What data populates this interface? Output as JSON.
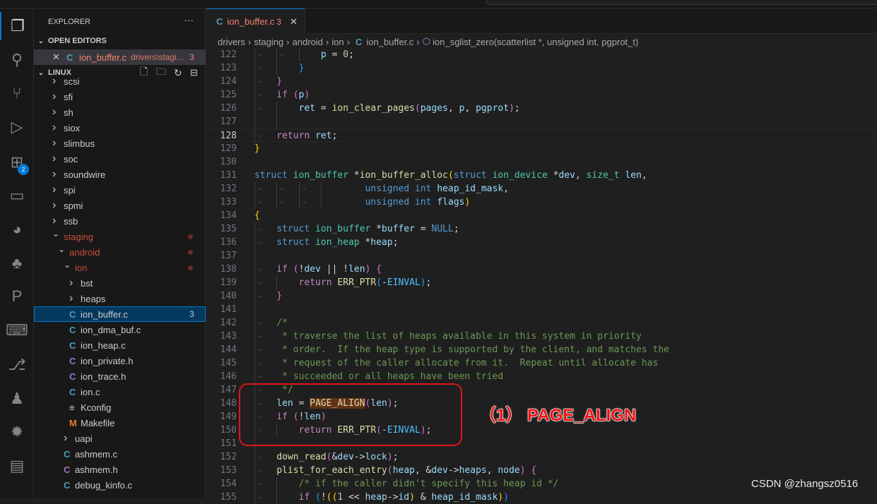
{
  "activity_bar": [
    {
      "icon": "explorer-icon",
      "glyph": "❐",
      "active": true
    },
    {
      "icon": "search-icon",
      "glyph": "⚲"
    },
    {
      "icon": "source-control-icon",
      "glyph": "⑂"
    },
    {
      "icon": "run-debug-icon",
      "glyph": "▷"
    },
    {
      "icon": "extensions-icon",
      "glyph": "⊞",
      "badge": "2"
    },
    {
      "icon": "remote-explorer-icon",
      "glyph": "▭"
    },
    {
      "icon": "pacman-icon",
      "glyph": "◕"
    },
    {
      "icon": "python-icon",
      "glyph": "♣"
    },
    {
      "icon": "p-extension-icon",
      "glyph": "P"
    },
    {
      "icon": "terminal-icon",
      "glyph": "⌨"
    },
    {
      "icon": "git-graph-icon",
      "glyph": "⎇"
    },
    {
      "icon": "linux-icon",
      "glyph": "♟"
    },
    {
      "icon": "rt-thread-icon",
      "glyph": "✹"
    },
    {
      "icon": "folder-icon",
      "glyph": "▤"
    }
  ],
  "sidebar": {
    "title": "EXPLORER",
    "more": "···",
    "open_editors": {
      "label": "OPEN EDITORS",
      "file": "ion_buffer.c",
      "path": "drivers\\stagi...",
      "count": "3"
    },
    "workspace": {
      "label": "LINUX"
    },
    "tree": [
      {
        "name": "scsi",
        "type": "folder",
        "depth": 0
      },
      {
        "name": "sfi",
        "type": "folder",
        "depth": 0
      },
      {
        "name": "sh",
        "type": "folder",
        "depth": 0
      },
      {
        "name": "siox",
        "type": "folder",
        "depth": 0
      },
      {
        "name": "slimbus",
        "type": "folder",
        "depth": 0
      },
      {
        "name": "soc",
        "type": "folder",
        "depth": 0
      },
      {
        "name": "soundwire",
        "type": "folder",
        "depth": 0
      },
      {
        "name": "spi",
        "type": "folder",
        "depth": 0
      },
      {
        "name": "spmi",
        "type": "folder",
        "depth": 0
      },
      {
        "name": "ssb",
        "type": "folder",
        "depth": 0
      },
      {
        "name": "staging",
        "type": "folder",
        "depth": 0,
        "open": true,
        "modified": true
      },
      {
        "name": "android",
        "type": "folder",
        "depth": 1,
        "open": true,
        "modified": true
      },
      {
        "name": "ion",
        "type": "folder",
        "depth": 2,
        "open": true,
        "modified": true
      },
      {
        "name": "bst",
        "type": "folder",
        "depth": 3
      },
      {
        "name": "heaps",
        "type": "folder",
        "depth": 3
      },
      {
        "name": "ion_buffer.c",
        "type": "c",
        "depth": 3,
        "selected": true,
        "count": "3"
      },
      {
        "name": "ion_dma_buf.c",
        "type": "c",
        "depth": 3
      },
      {
        "name": "ion_heap.c",
        "type": "c",
        "depth": 3
      },
      {
        "name": "ion_private.h",
        "type": "h",
        "depth": 3
      },
      {
        "name": "ion_trace.h",
        "type": "h",
        "depth": 3
      },
      {
        "name": "ion.c",
        "type": "c",
        "depth": 3
      },
      {
        "name": "Kconfig",
        "type": "kconfig",
        "depth": 3
      },
      {
        "name": "Makefile",
        "type": "make",
        "depth": 3
      },
      {
        "name": "uapi",
        "type": "folder",
        "depth": 2
      },
      {
        "name": "ashmem.c",
        "type": "c",
        "depth": 2
      },
      {
        "name": "ashmem.h",
        "type": "h",
        "depth": 2
      },
      {
        "name": "debug_kinfo.c",
        "type": "c",
        "depth": 2
      }
    ]
  },
  "editor": {
    "tab": {
      "file": "ion_buffer.c",
      "count": "3"
    },
    "breadcrumb": [
      "drivers",
      "staging",
      "android",
      "ion",
      "ion_buffer.c",
      "ion_sglist_zero(scatterlist *, unsigned int, pgprot_t)"
    ],
    "current_line": 128,
    "lines": [
      {
        "n": 122,
        "i": 3,
        "g": 3,
        "t": [
          [
            "v",
            "p"
          ],
          [
            "p",
            " = "
          ],
          [
            "n",
            "0"
          ],
          [
            "p",
            ";"
          ]
        ]
      },
      {
        "n": 123,
        "i": 2,
        "g": 2,
        "t": [
          [
            "b3",
            "}"
          ]
        ]
      },
      {
        "n": 124,
        "i": 1,
        "g": 1,
        "t": [
          [
            "b2",
            "}"
          ]
        ]
      },
      {
        "n": 125,
        "i": 1,
        "g": 1,
        "t": [
          [
            "c",
            "if"
          ],
          [
            "p",
            " "
          ],
          [
            "b2",
            "("
          ],
          [
            "v",
            "p"
          ],
          [
            "b2",
            ")"
          ]
        ]
      },
      {
        "n": 126,
        "i": 2,
        "g": 2,
        "t": [
          [
            "v",
            "ret"
          ],
          [
            "p",
            " = "
          ],
          [
            "f",
            "ion_clear_pages"
          ],
          [
            "b2",
            "("
          ],
          [
            "v",
            "pages"
          ],
          [
            "p",
            ", "
          ],
          [
            "v",
            "p"
          ],
          [
            "p",
            ", "
          ],
          [
            "v",
            "pgprot"
          ],
          [
            "b2",
            ")"
          ],
          [
            "p",
            ";"
          ]
        ]
      },
      {
        "n": 127,
        "i": 0,
        "g": 2,
        "t": []
      },
      {
        "n": 128,
        "i": 1,
        "g": 1,
        "t": [
          [
            "c",
            "return"
          ],
          [
            "p",
            " "
          ],
          [
            "v",
            "ret"
          ],
          [
            "p",
            ";"
          ]
        ]
      },
      {
        "n": 129,
        "i": 0,
        "g": 0,
        "t": [
          [
            "b1",
            "}"
          ]
        ]
      },
      {
        "n": 130,
        "i": 0,
        "g": 0,
        "t": []
      },
      {
        "n": 131,
        "i": 0,
        "g": 0,
        "t": [
          [
            "k",
            "struct"
          ],
          [
            "p",
            " "
          ],
          [
            "t",
            "ion_buffer"
          ],
          [
            "p",
            " *"
          ],
          [
            "f",
            "ion_buffer_alloc"
          ],
          [
            "b1",
            "("
          ],
          [
            "k",
            "struct"
          ],
          [
            "p",
            " "
          ],
          [
            "t",
            "ion_device"
          ],
          [
            "p",
            " *"
          ],
          [
            "v",
            "dev"
          ],
          [
            "p",
            ", "
          ],
          [
            "t",
            "size_t"
          ],
          [
            "p",
            " "
          ],
          [
            "v",
            "len"
          ],
          [
            "p",
            ","
          ]
        ]
      },
      {
        "n": 132,
        "i": 4,
        "g": 4,
        "t": [
          [
            "p",
            "    "
          ],
          [
            "k",
            "unsigned"
          ],
          [
            "p",
            " "
          ],
          [
            "k",
            "int"
          ],
          [
            "p",
            " "
          ],
          [
            "v",
            "heap_id_mask"
          ],
          [
            "p",
            ","
          ]
        ]
      },
      {
        "n": 133,
        "i": 4,
        "g": 4,
        "t": [
          [
            "p",
            "    "
          ],
          [
            "k",
            "unsigned"
          ],
          [
            "p",
            " "
          ],
          [
            "k",
            "int"
          ],
          [
            "p",
            " "
          ],
          [
            "v",
            "flags"
          ],
          [
            "b1",
            ")"
          ]
        ]
      },
      {
        "n": 134,
        "i": 0,
        "g": 0,
        "t": [
          [
            "b1",
            "{"
          ]
        ]
      },
      {
        "n": 135,
        "i": 1,
        "g": 1,
        "t": [
          [
            "k",
            "struct"
          ],
          [
            "p",
            " "
          ],
          [
            "t",
            "ion_buffer"
          ],
          [
            "p",
            " *"
          ],
          [
            "v",
            "buffer"
          ],
          [
            "p",
            " = "
          ],
          [
            "k",
            "NULL"
          ],
          [
            "p",
            ";"
          ]
        ]
      },
      {
        "n": 136,
        "i": 1,
        "g": 1,
        "t": [
          [
            "k",
            "struct"
          ],
          [
            "p",
            " "
          ],
          [
            "t",
            "ion_heap"
          ],
          [
            "p",
            " *"
          ],
          [
            "v",
            "heap"
          ],
          [
            "p",
            ";"
          ]
        ]
      },
      {
        "n": 137,
        "i": 0,
        "g": 1,
        "t": []
      },
      {
        "n": 138,
        "i": 1,
        "g": 1,
        "t": [
          [
            "c",
            "if"
          ],
          [
            "p",
            " "
          ],
          [
            "b2",
            "("
          ],
          [
            "p",
            "!"
          ],
          [
            "v",
            "dev"
          ],
          [
            "p",
            " || !"
          ],
          [
            "v",
            "len"
          ],
          [
            "b2",
            ")"
          ],
          [
            "p",
            " "
          ],
          [
            "b2",
            "{"
          ]
        ]
      },
      {
        "n": 139,
        "i": 2,
        "g": 2,
        "t": [
          [
            "c",
            "return"
          ],
          [
            "p",
            " "
          ],
          [
            "f",
            "ERR_PTR"
          ],
          [
            "b3",
            "("
          ],
          [
            "p",
            "-"
          ],
          [
            "cs",
            "EINVAL"
          ],
          [
            "b3",
            ")"
          ],
          [
            "p",
            ";"
          ]
        ]
      },
      {
        "n": 140,
        "i": 1,
        "g": 1,
        "t": [
          [
            "b2",
            "}"
          ]
        ]
      },
      {
        "n": 141,
        "i": 0,
        "g": 1,
        "t": []
      },
      {
        "n": 142,
        "i": 1,
        "g": 1,
        "t": [
          [
            "m",
            "/*"
          ]
        ]
      },
      {
        "n": 143,
        "i": 1,
        "g": 1,
        "t": [
          [
            "m",
            " * traverse the list of heaps available in this system in priority"
          ]
        ]
      },
      {
        "n": 144,
        "i": 1,
        "g": 1,
        "t": [
          [
            "m",
            " * order.  If the heap type is supported by the client, and matches the"
          ]
        ]
      },
      {
        "n": 145,
        "i": 1,
        "g": 1,
        "t": [
          [
            "m",
            " * request of the caller allocate from it.  Repeat until allocate has"
          ]
        ]
      },
      {
        "n": 146,
        "i": 1,
        "g": 1,
        "t": [
          [
            "m",
            " * succeeded or all heaps have been tried"
          ]
        ]
      },
      {
        "n": 147,
        "i": 1,
        "g": 1,
        "t": [
          [
            "m",
            " */"
          ]
        ]
      },
      {
        "n": 148,
        "i": 1,
        "g": 1,
        "t": [
          [
            "v",
            "len"
          ],
          [
            "p",
            " = "
          ],
          [
            "hl",
            "PAGE_ALIGN"
          ],
          [
            "b2",
            "("
          ],
          [
            "v",
            "len"
          ],
          [
            "b2",
            ")"
          ],
          [
            "p",
            ";"
          ]
        ]
      },
      {
        "n": 149,
        "i": 1,
        "g": 1,
        "t": [
          [
            "c",
            "if"
          ],
          [
            "p",
            " "
          ],
          [
            "b2",
            "("
          ],
          [
            "p",
            "!"
          ],
          [
            "v",
            "len"
          ],
          [
            "b2",
            ")"
          ]
        ]
      },
      {
        "n": 150,
        "i": 2,
        "g": 2,
        "t": [
          [
            "c",
            "return"
          ],
          [
            "p",
            " "
          ],
          [
            "f",
            "ERR_PTR"
          ],
          [
            "b2",
            "("
          ],
          [
            "p",
            "-"
          ],
          [
            "cs",
            "EINVAL"
          ],
          [
            "b2",
            ")"
          ],
          [
            "p",
            ";"
          ]
        ]
      },
      {
        "n": 151,
        "i": 0,
        "g": 1,
        "t": []
      },
      {
        "n": 152,
        "i": 1,
        "g": 1,
        "t": [
          [
            "f",
            "down_read"
          ],
          [
            "b2",
            "("
          ],
          [
            "p",
            "&"
          ],
          [
            "v",
            "dev"
          ],
          [
            "p",
            "->"
          ],
          [
            "v",
            "lock"
          ],
          [
            "b2",
            ")"
          ],
          [
            "p",
            ";"
          ]
        ]
      },
      {
        "n": 153,
        "i": 1,
        "g": 1,
        "t": [
          [
            "f",
            "plist_for_each_entry"
          ],
          [
            "b2",
            "("
          ],
          [
            "v",
            "heap"
          ],
          [
            "p",
            ", &"
          ],
          [
            "v",
            "dev"
          ],
          [
            "p",
            "->"
          ],
          [
            "v",
            "heaps"
          ],
          [
            "p",
            ", "
          ],
          [
            "v",
            "node"
          ],
          [
            "b2",
            ")"
          ],
          [
            "p",
            " "
          ],
          [
            "b2",
            "{"
          ]
        ]
      },
      {
        "n": 154,
        "i": 2,
        "g": 2,
        "t": [
          [
            "m",
            "/* if the caller didn't specify this heap id */"
          ]
        ]
      },
      {
        "n": 155,
        "i": 2,
        "g": 2,
        "t": [
          [
            "c",
            "if"
          ],
          [
            "p",
            " "
          ],
          [
            "b3",
            "("
          ],
          [
            "p",
            "!"
          ],
          [
            "b1",
            "(("
          ],
          [
            "n",
            "1"
          ],
          [
            "p",
            " << "
          ],
          [
            "v",
            "heap"
          ],
          [
            "p",
            "->"
          ],
          [
            "v",
            "id"
          ],
          [
            "b1",
            ")"
          ],
          [
            "p",
            " & "
          ],
          [
            "v",
            "heap_id_mask"
          ],
          [
            "b1",
            ")"
          ],
          [
            "b3",
            ")"
          ]
        ]
      }
    ]
  },
  "annotation": {
    "label": "（1） PAGE_ALIGN",
    "color": "#e0141a"
  },
  "watermark": "CSDN @zhangsz0516",
  "colors": {
    "accent": "#0078d4",
    "selection": "#04395e",
    "error": "#f48771"
  }
}
